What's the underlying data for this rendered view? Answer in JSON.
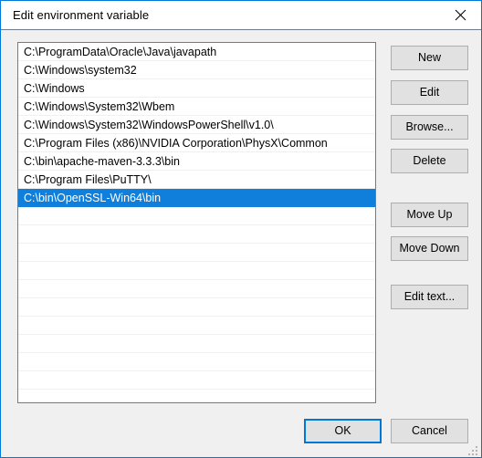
{
  "window": {
    "title": "Edit environment variable",
    "close_icon": "close-icon",
    "border_color": "#0078d7",
    "body_background": "#f0f0f0"
  },
  "listbox": {
    "selection_color": "#0f7fdb",
    "selection_text_color": "#ffffff",
    "selected_index": 8,
    "visible_empty_rows": 11,
    "items": [
      "C:\\ProgramData\\Oracle\\Java\\javapath",
      "C:\\Windows\\system32",
      "C:\\Windows",
      "C:\\Windows\\System32\\Wbem",
      "C:\\Windows\\System32\\WindowsPowerShell\\v1.0\\",
      "C:\\Program Files (x86)\\NVIDIA Corporation\\PhysX\\Common",
      "C:\\bin\\apache-maven-3.3.3\\bin",
      "C:\\Program Files\\PuTTY\\",
      "C:\\bin\\OpenSSL-Win64\\bin"
    ]
  },
  "side_buttons": {
    "new": "New",
    "edit": "Edit",
    "browse": "Browse...",
    "delete": "Delete",
    "move_up": "Move Up",
    "move_down": "Move Down",
    "edit_text": "Edit text..."
  },
  "bottom_buttons": {
    "ok": "OK",
    "cancel": "Cancel",
    "focus_color": "#0078d7"
  }
}
